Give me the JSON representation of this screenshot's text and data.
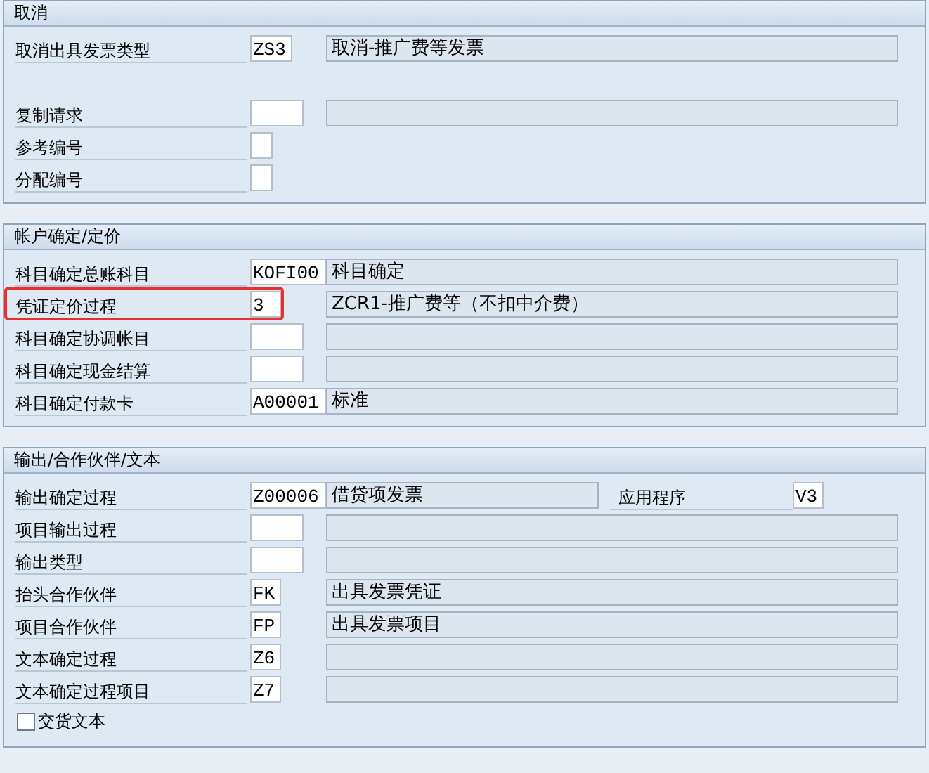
{
  "sections": [
    {
      "title": "取消",
      "rows": [
        {
          "kind": "field",
          "label": "取消出具发票类型",
          "code": "ZS3",
          "desc": "取消-推广费等发票",
          "highlighted": false
        },
        {
          "kind": "blank"
        },
        {
          "kind": "field",
          "label": "复制请求",
          "code": "",
          "desc": "",
          "highlighted": false
        },
        {
          "kind": "field",
          "label": "参考编号",
          "code": "",
          "highlighted": false
        },
        {
          "kind": "field",
          "label": "分配编号",
          "code": "",
          "highlighted": false
        }
      ]
    },
    {
      "title": "帐户确定/定价",
      "rows": [
        {
          "kind": "field",
          "label": "科目确定总账科目",
          "code": "KOFI00",
          "desc": "科目确定",
          "highlighted": false
        },
        {
          "kind": "field",
          "label": "凭证定价过程",
          "code": "3",
          "desc": "ZCR1-推广费等（不扣中介费）",
          "highlighted": true
        },
        {
          "kind": "field",
          "label": "科目确定协调帐目",
          "code": "",
          "desc": "",
          "highlighted": false
        },
        {
          "kind": "field",
          "label": "科目确定现金结算",
          "code": "",
          "desc": "",
          "highlighted": false
        },
        {
          "kind": "field",
          "label": "科目确定付款卡",
          "code": "A00001",
          "desc": "标准",
          "highlighted": false
        }
      ]
    },
    {
      "title": "输出/合作伙伴/文本",
      "rows": [
        {
          "kind": "field",
          "label": "输出确定过程",
          "code": "Z00006",
          "desc": "借贷项发票",
          "highlighted": false,
          "extra": {
            "label": "应用程序",
            "code": "V3"
          }
        },
        {
          "kind": "field",
          "label": "项目输出过程",
          "code": "",
          "desc": "",
          "highlighted": false
        },
        {
          "kind": "field",
          "label": "输出类型",
          "code": "",
          "desc": "",
          "highlighted": false
        },
        {
          "kind": "field",
          "label": "抬头合作伙伴",
          "code": "FK",
          "desc": "出具发票凭证",
          "highlighted": false
        },
        {
          "kind": "field",
          "label": "项目合作伙伴",
          "code": "FP",
          "desc": "出具发票项目",
          "highlighted": false
        },
        {
          "kind": "field",
          "label": "文本确定过程",
          "code": "Z6",
          "desc": "",
          "highlighted": false
        },
        {
          "kind": "field",
          "label": "文本确定过程项目",
          "code": "Z7",
          "desc": "",
          "highlighted": false
        },
        {
          "kind": "checkbox",
          "label": "交货文本",
          "checked": false
        }
      ]
    }
  ]
}
